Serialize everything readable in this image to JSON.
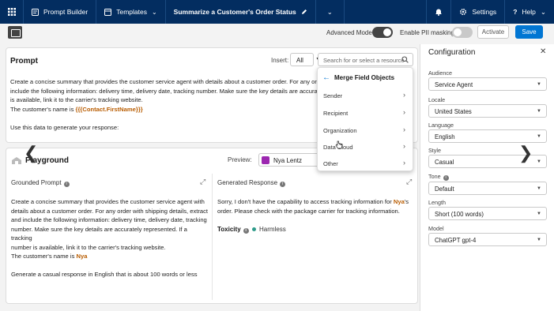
{
  "topbar": {
    "app": "Prompt Builder",
    "templates": "Templates",
    "title": "Summarize a Customer's Order Status",
    "settings": "Settings",
    "help": "Help"
  },
  "toolbar": {
    "advanced_mode": "Advanced Mode",
    "advanced_mode_on": true,
    "pii_masking": "Enable PII masking",
    "pii_masking_on": false,
    "activate": "Activate",
    "save": "Save"
  },
  "prompt": {
    "title": "Prompt",
    "insert_label": "Insert:",
    "insert_value": "All",
    "search_placeholder": "Search for or select a resource",
    "line1": "Create a concise summary that provides the customer service agent with details about a customer order. For any order",
    "line2": "include the following information: delivery time, delivery date, tracking number. Make sure the key details are accurate",
    "line3": "is available, link it to the carrier's tracking website.",
    "line4_prefix": "The customer's name is ",
    "merge_field": "{{{Contact.FirstName}}}",
    "line5": "Use this data to generate your response:"
  },
  "merge_menu": {
    "title": "Merge Field Objects",
    "items": [
      "Sender",
      "Recipient",
      "Organization",
      "Data Cloud",
      "Other"
    ]
  },
  "playground": {
    "title": "Playground",
    "preview_label": "Preview:",
    "preview_value": "Nya Lentz",
    "grounded_title": "Grounded Prompt",
    "generated_title": "Generated Response",
    "grounded_l1": "Create a concise summary that provides the customer service agent with",
    "grounded_l2": "details about a customer order. For any order with shipping details, extract",
    "grounded_l3": "and include the following information: delivery time, delivery date, tracking",
    "grounded_l4": "number. Make sure the key details are accurately represented. If a tracking",
    "grounded_l5": "number is available, link it to the carrier's tracking website.",
    "grounded_l6_prefix": "The customer's name is ",
    "grounded_name": "Nya",
    "grounded_l7": "Generate a casual response in English that is about 100 words or less",
    "gen_l1_prefix": "Sorry, I don't have the capability to access tracking information for ",
    "gen_name": "Nya",
    "gen_l1_suffix": "'s",
    "gen_l2": "order. Please check with the package carrier for tracking information.",
    "toxicity_label": "Toxicity",
    "toxicity_value": "Harmless"
  },
  "config": {
    "title": "Configuration",
    "fields": [
      {
        "label": "Audience",
        "value": "Service Agent"
      },
      {
        "label": "Locale",
        "value": "United States"
      },
      {
        "label": "Language",
        "value": "English"
      },
      {
        "label": "Style",
        "value": "Casual"
      },
      {
        "label": "Tone",
        "value": "Default"
      },
      {
        "label": "Length",
        "value": "Short (100 words)"
      },
      {
        "label": "Model",
        "value": "ChatGPT gpt-4"
      }
    ]
  },
  "colors": {
    "nav": "#032d60",
    "brand": "#0176d3",
    "merge": "#b85c00",
    "harmless": "#2e9b8a"
  },
  "icons": [
    "app-grid-icon",
    "prompt-builder-icon",
    "templates-icon",
    "pencil-icon",
    "chevron-down-icon",
    "gear-icon",
    "help-icon",
    "bell-icon",
    "search-icon",
    "arrow-left-icon",
    "chevron-right-icon",
    "info-icon",
    "expand-icon",
    "close-icon",
    "playground-icon"
  ]
}
